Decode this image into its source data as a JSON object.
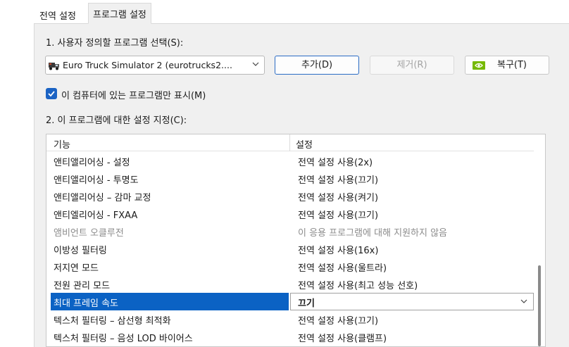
{
  "tabs": [
    {
      "label": "전역 설정"
    },
    {
      "label": "프로그램 설정"
    }
  ],
  "section1": {
    "label": "1. 사용자 정의할 프로그램 선택(S):",
    "program_select": {
      "value": "Euro Truck Simulator 2 (eurotrucks2...."
    },
    "add_button": "추가(D)",
    "remove_button": "제거(R)",
    "restore_button": "복구(T)",
    "show_only_checkbox": {
      "label": "이 컴퓨터에 있는 프로그램만 표시(M)",
      "checked": true
    }
  },
  "section2": {
    "label": "2. 이 프로그램에 대한 설정 지정(C):",
    "columns": [
      "기능",
      "설정"
    ],
    "rows": [
      {
        "feature": "앤티앨리어싱 - 설정",
        "setting": "전역 설정 사용(2x)"
      },
      {
        "feature": "앤티앨리어싱 - 투명도",
        "setting": "전역 설정 사용(끄기)"
      },
      {
        "feature": "앤티앨리어싱 – 감마 교정",
        "setting": "전역 설정 사용(켜기)"
      },
      {
        "feature": "앤티엘리어싱 - FXAA",
        "setting": "전역 설정 사용(끄기)"
      },
      {
        "feature": "앰비언트 오클루전",
        "setting": "이 응용 프로그램에 대해 지원하지 않음"
      },
      {
        "feature": "이방성 필터링",
        "setting": "전역 설정 사용(16x)"
      },
      {
        "feature": "저지연 모드",
        "setting": "전역 설정 사용(울트라)"
      },
      {
        "feature": "전원 관리 모드",
        "setting": "전역 설정 사용(최고 성능 선호)"
      },
      {
        "feature": "최대 프레임 속도",
        "setting": "끄기"
      },
      {
        "feature": "텍스처 필터링 – 삼선형 최적화",
        "setting": "전역 설정 사용(끄기)"
      },
      {
        "feature": "텍스처 필터링 – 음성 LOD 바이어스",
        "setting": "전역 설정 사용(클램프)"
      }
    ]
  },
  "colors": {
    "accent": "#0b62c4",
    "nvidia": "#76b900"
  }
}
